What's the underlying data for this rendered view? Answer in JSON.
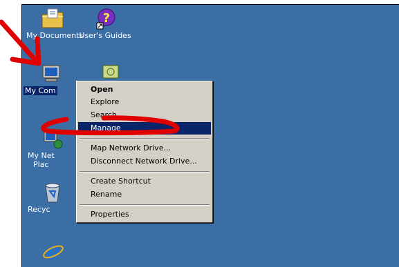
{
  "desktop": {
    "background_color": "#3a6ea5",
    "icons": [
      {
        "name": "My Documents",
        "icon": "folder-icon"
      },
      {
        "name": "User's Guides",
        "icon": "help-icon"
      },
      {
        "name": "My Computer",
        "icon": "computer-icon",
        "truncated_label": "My Com"
      },
      {
        "name": "My Network Places",
        "icon": "network-icon",
        "truncated_label_1": "My Net",
        "truncated_label_2": "Plac"
      },
      {
        "name": "Recycle Bin",
        "icon": "recycle-bin-icon",
        "truncated_label": "Recyc"
      },
      {
        "name": "Internet Explorer",
        "icon": "internet-explorer-icon"
      }
    ]
  },
  "context_menu": {
    "items": [
      {
        "label": "Open",
        "bold": true
      },
      {
        "label": "Explore"
      },
      {
        "label": "Search..."
      },
      {
        "label": "Manage",
        "selected": true
      },
      {
        "label": "Map Network Drive..."
      },
      {
        "label": "Disconnect Network Drive..."
      },
      {
        "label": "Create Shortcut"
      },
      {
        "label": "Rename"
      },
      {
        "label": "Properties"
      }
    ]
  },
  "annotation": {
    "color": "#e00000",
    "shapes": [
      "arrow-pointing-at-my-computer",
      "ellipse-around-manage"
    ]
  }
}
